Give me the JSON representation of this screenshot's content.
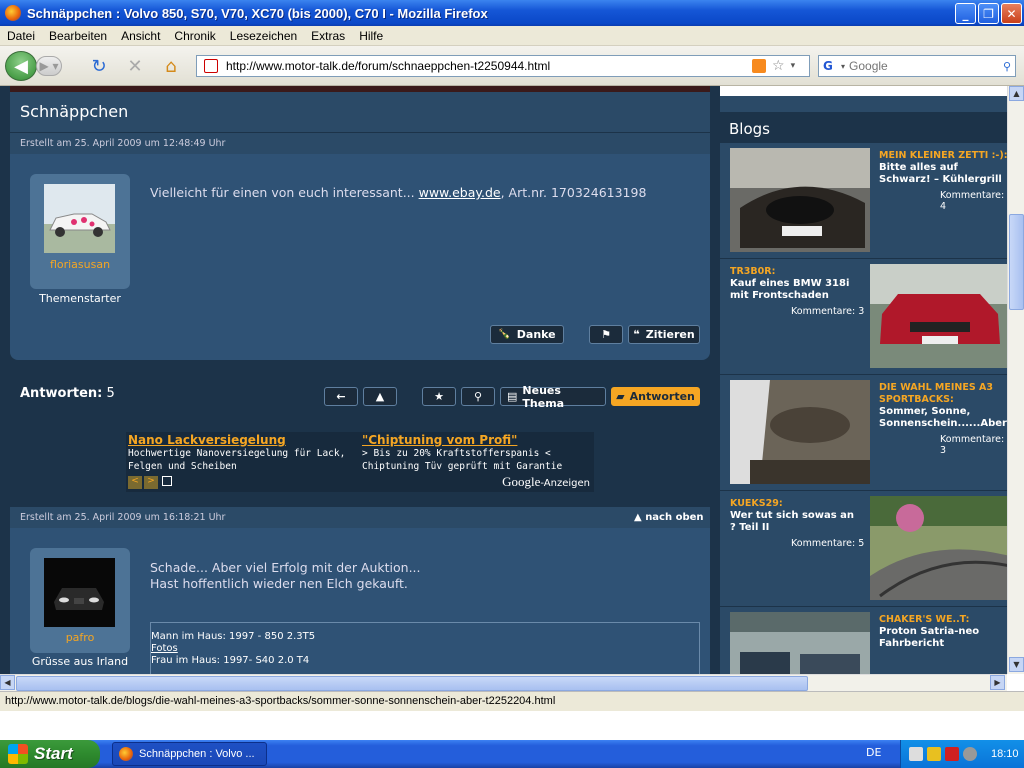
{
  "window": {
    "title": "Schnäppchen : Volvo 850, S70, V70, XC70 (bis 2000), C70 I - Mozilla Firefox"
  },
  "menu": [
    "Datei",
    "Bearbeiten",
    "Ansicht",
    "Chronik",
    "Lesezeichen",
    "Extras",
    "Hilfe"
  ],
  "nav": {
    "url": "http://www.motor-talk.de/forum/schnaeppchen-t2250944.html",
    "search_placeholder": "Google"
  },
  "page": {
    "title": "Schnäppchen",
    "post1": {
      "meta": "Erstellt am 25. April 2009 um 12:48:49 Uhr",
      "text_before": "Vielleicht für einen von euch interessant...",
      "link": "www.ebay.de",
      "text_after": ", Art.nr. 170324613198",
      "username": "floriasusan",
      "role": "Themenstarter",
      "btn_danke": "Danke",
      "btn_zitieren": "Zitieren"
    },
    "answers_label": "Antworten:",
    "answers_count": "5",
    "btn_new_thread": "Neues Thema",
    "btn_reply": "Antworten",
    "ad": {
      "ad1_title": "Nano Lackversiegelung",
      "ad1_line1": "Hochwertige Nanoversiegelung für Lack,",
      "ad1_line2": "Felgen und Scheiben",
      "ad2_title": "\"Chiptuning vom Profi\"",
      "ad2_line1": "> Bis zu 20% Kraftstofferspanis <",
      "ad2_line2": "Chiptuning Tüv geprüft mit Garantie",
      "google": "Google",
      "anzeigen": "-Anzeigen"
    },
    "post2": {
      "meta": "Erstellt am 25. April 2009 um 16:18:21 Uhr",
      "nach_oben": "nach oben",
      "line1": "Schade... Aber viel Erfolg mit der Auktion...",
      "line2": "Hast hoffentlich wieder nen Elch gekauft.",
      "username": "pafro",
      "role": "Grüsse aus Irland",
      "sig1": "Mann im Haus: 1997 - 850 2.3T5",
      "sig2": "Fotos",
      "sig3": "Frau im Haus: 1997- S40 2.0 T4"
    }
  },
  "sidebar": {
    "heading": "Blogs",
    "entries": [
      {
        "category": "MEIN KLEINER ZETTI :-):",
        "title": "Bitte alles auf Schwarz! – Kühlergrill",
        "comments": "Kommentare: 4"
      },
      {
        "category": "TR3B0R:",
        "title": "Kauf eines BMW 318i mit Frontschaden",
        "comments": "Kommentare: 3"
      },
      {
        "category": "DIE WAHL MEINES A3 SPORTBACKS:",
        "title": "Sommer, Sonne, Sonnenschein......Aber!!!!!",
        "comments": "Kommentare: 3"
      },
      {
        "category": "KUEKS29:",
        "title": "Wer tut sich sowas an ? Teil II",
        "comments": "Kommentare: 5"
      },
      {
        "category": "CHAKER'S WE..T:",
        "title": "Proton Satria-neo Fahrbericht",
        "comments": ""
      }
    ]
  },
  "status": "http://www.motor-talk.de/blogs/die-wahl-meines-a3-sportbacks/sommer-sonne-sonnenschein-aber-t2252204.html",
  "taskbar": {
    "start": "Start",
    "task": "Schnäppchen : Volvo ...",
    "lang": "DE",
    "clock": "18:10"
  }
}
